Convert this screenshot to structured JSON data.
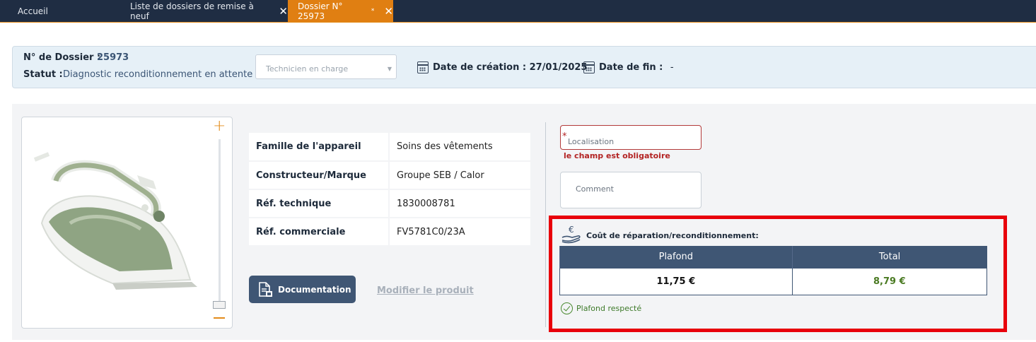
{
  "tabs": {
    "home": "Accueil",
    "list": "Liste de dossiers de remise à neuf",
    "active": "Dossier N° 25973",
    "active_marker": "*",
    "close_glyph": "✕"
  },
  "header": {
    "dossier_label": "N° de Dossier :",
    "dossier_value": "25973",
    "statut_label": "Statut :",
    "statut_value": "Diagnostic reconditionnement en attente",
    "technicien_placeholder": "Technicien en charge",
    "date_creation_label": "Date de création :",
    "date_creation_value": "27/01/2025",
    "date_fin_label": "Date de fin :",
    "date_fin_value": "-"
  },
  "specs": [
    {
      "key": "Famille de l'appareil",
      "value": "Soins des vêtements"
    },
    {
      "key": "Constructeur/Marque",
      "value": "Groupe SEB / Calor"
    },
    {
      "key": "Réf. technique",
      "value": "1830008781"
    },
    {
      "key": "Réf. commerciale",
      "value": "FV5781C0/23A"
    }
  ],
  "actions": {
    "documentation": "Documentation",
    "modifier": "Modifier le produit"
  },
  "form": {
    "required_mark": "*",
    "localisation_placeholder": "Localisation",
    "localisation_error": "le champ est obligatoire",
    "comment_placeholder": "Comment"
  },
  "cost": {
    "title": "Coût de réparation/reconditionnement:",
    "col_plafond": "Plafond",
    "col_total": "Total",
    "plafond_value": "11,75 €",
    "total_value": "8,79 €",
    "status": "Plafond respecté"
  },
  "colors": {
    "navbar": "#1f2d43",
    "active_tab": "#e07f12",
    "primary_button": "#3f5674",
    "error": "#b32424",
    "highlight": "#e8000b",
    "success": "#4a7a22"
  }
}
